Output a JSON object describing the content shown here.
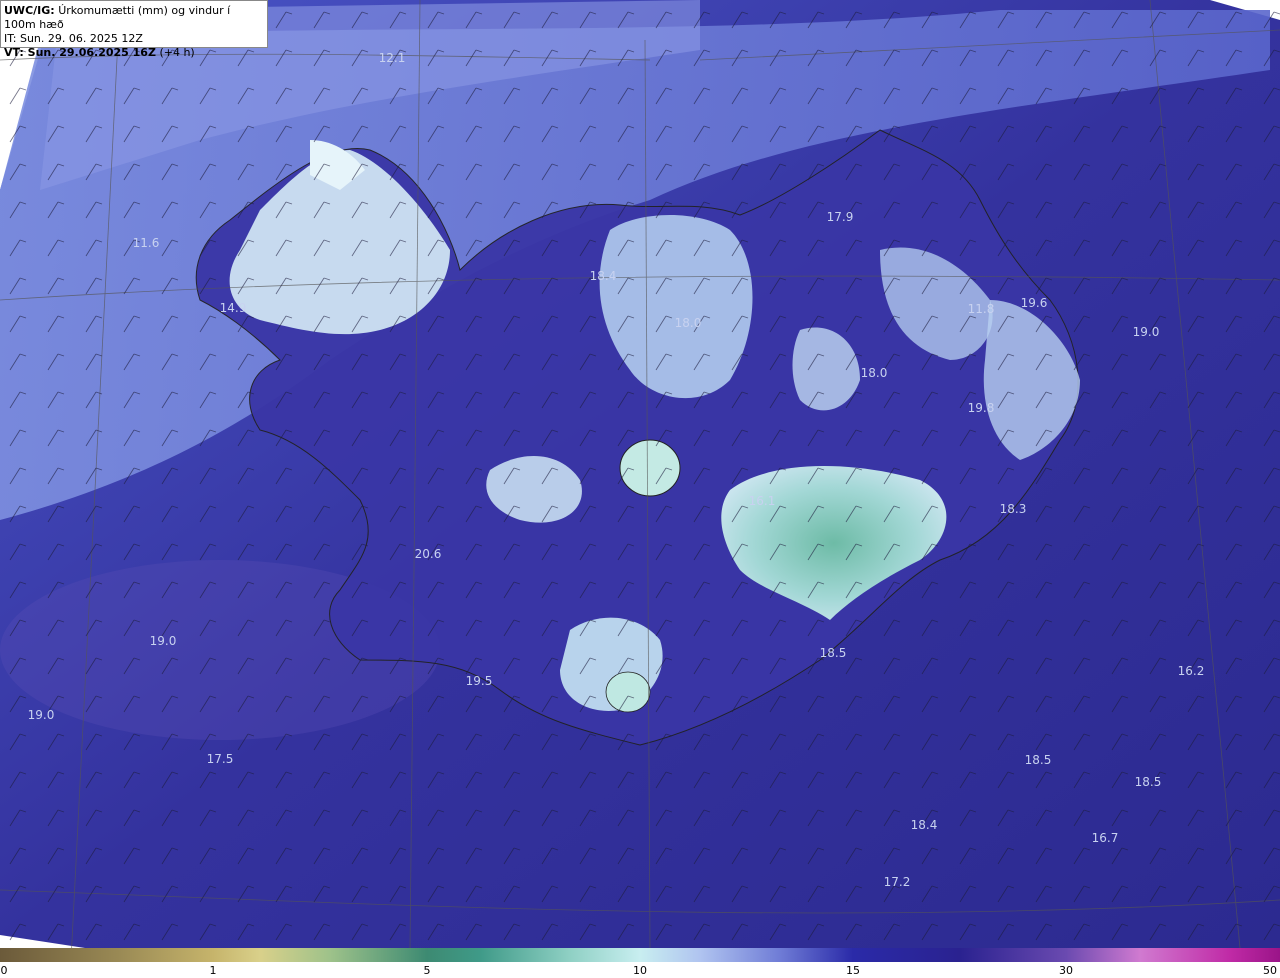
{
  "header": {
    "product": "UWC/IG:",
    "title": "Úrkomumætti (mm) og vindur í 100m hæð",
    "init_time": "IT: Sun. 29. 06. 2025 12Z",
    "valid_prefix": "VT: Sun. 29.06.2025 16Z",
    "valid_suffix": "(+4 h)"
  },
  "map_values": [
    {
      "text": "12.1"
    },
    {
      "text": "11.6"
    },
    {
      "text": "14.9"
    },
    {
      "text": "18.4"
    },
    {
      "text": "18.0"
    },
    {
      "text": "17.9"
    },
    {
      "text": "11.8"
    },
    {
      "text": "19.6"
    },
    {
      "text": "19.0"
    },
    {
      "text": "18.0"
    },
    {
      "text": "19.8"
    },
    {
      "text": "18.3"
    },
    {
      "text": "16.1"
    },
    {
      "text": "20.6"
    },
    {
      "text": "19.0"
    },
    {
      "text": "19.5"
    },
    {
      "text": "18.5"
    },
    {
      "text": "19.0"
    },
    {
      "text": "17.5"
    },
    {
      "text": "16.2"
    },
    {
      "text": "18.5"
    },
    {
      "text": "18.5"
    },
    {
      "text": "18.4"
    },
    {
      "text": "16.7"
    },
    {
      "text": "17.2"
    }
  ],
  "colorbar": {
    "ticks": [
      "0",
      "1",
      "5",
      "10",
      "15",
      "30",
      "50"
    ]
  },
  "colors": {
    "ocean_dark": "#2c2a90",
    "ocean_mid": "#3a3db0",
    "moist_band": "#6f80d8",
    "land_high": "#c8eef0",
    "land_peak": "#78c8ac"
  }
}
